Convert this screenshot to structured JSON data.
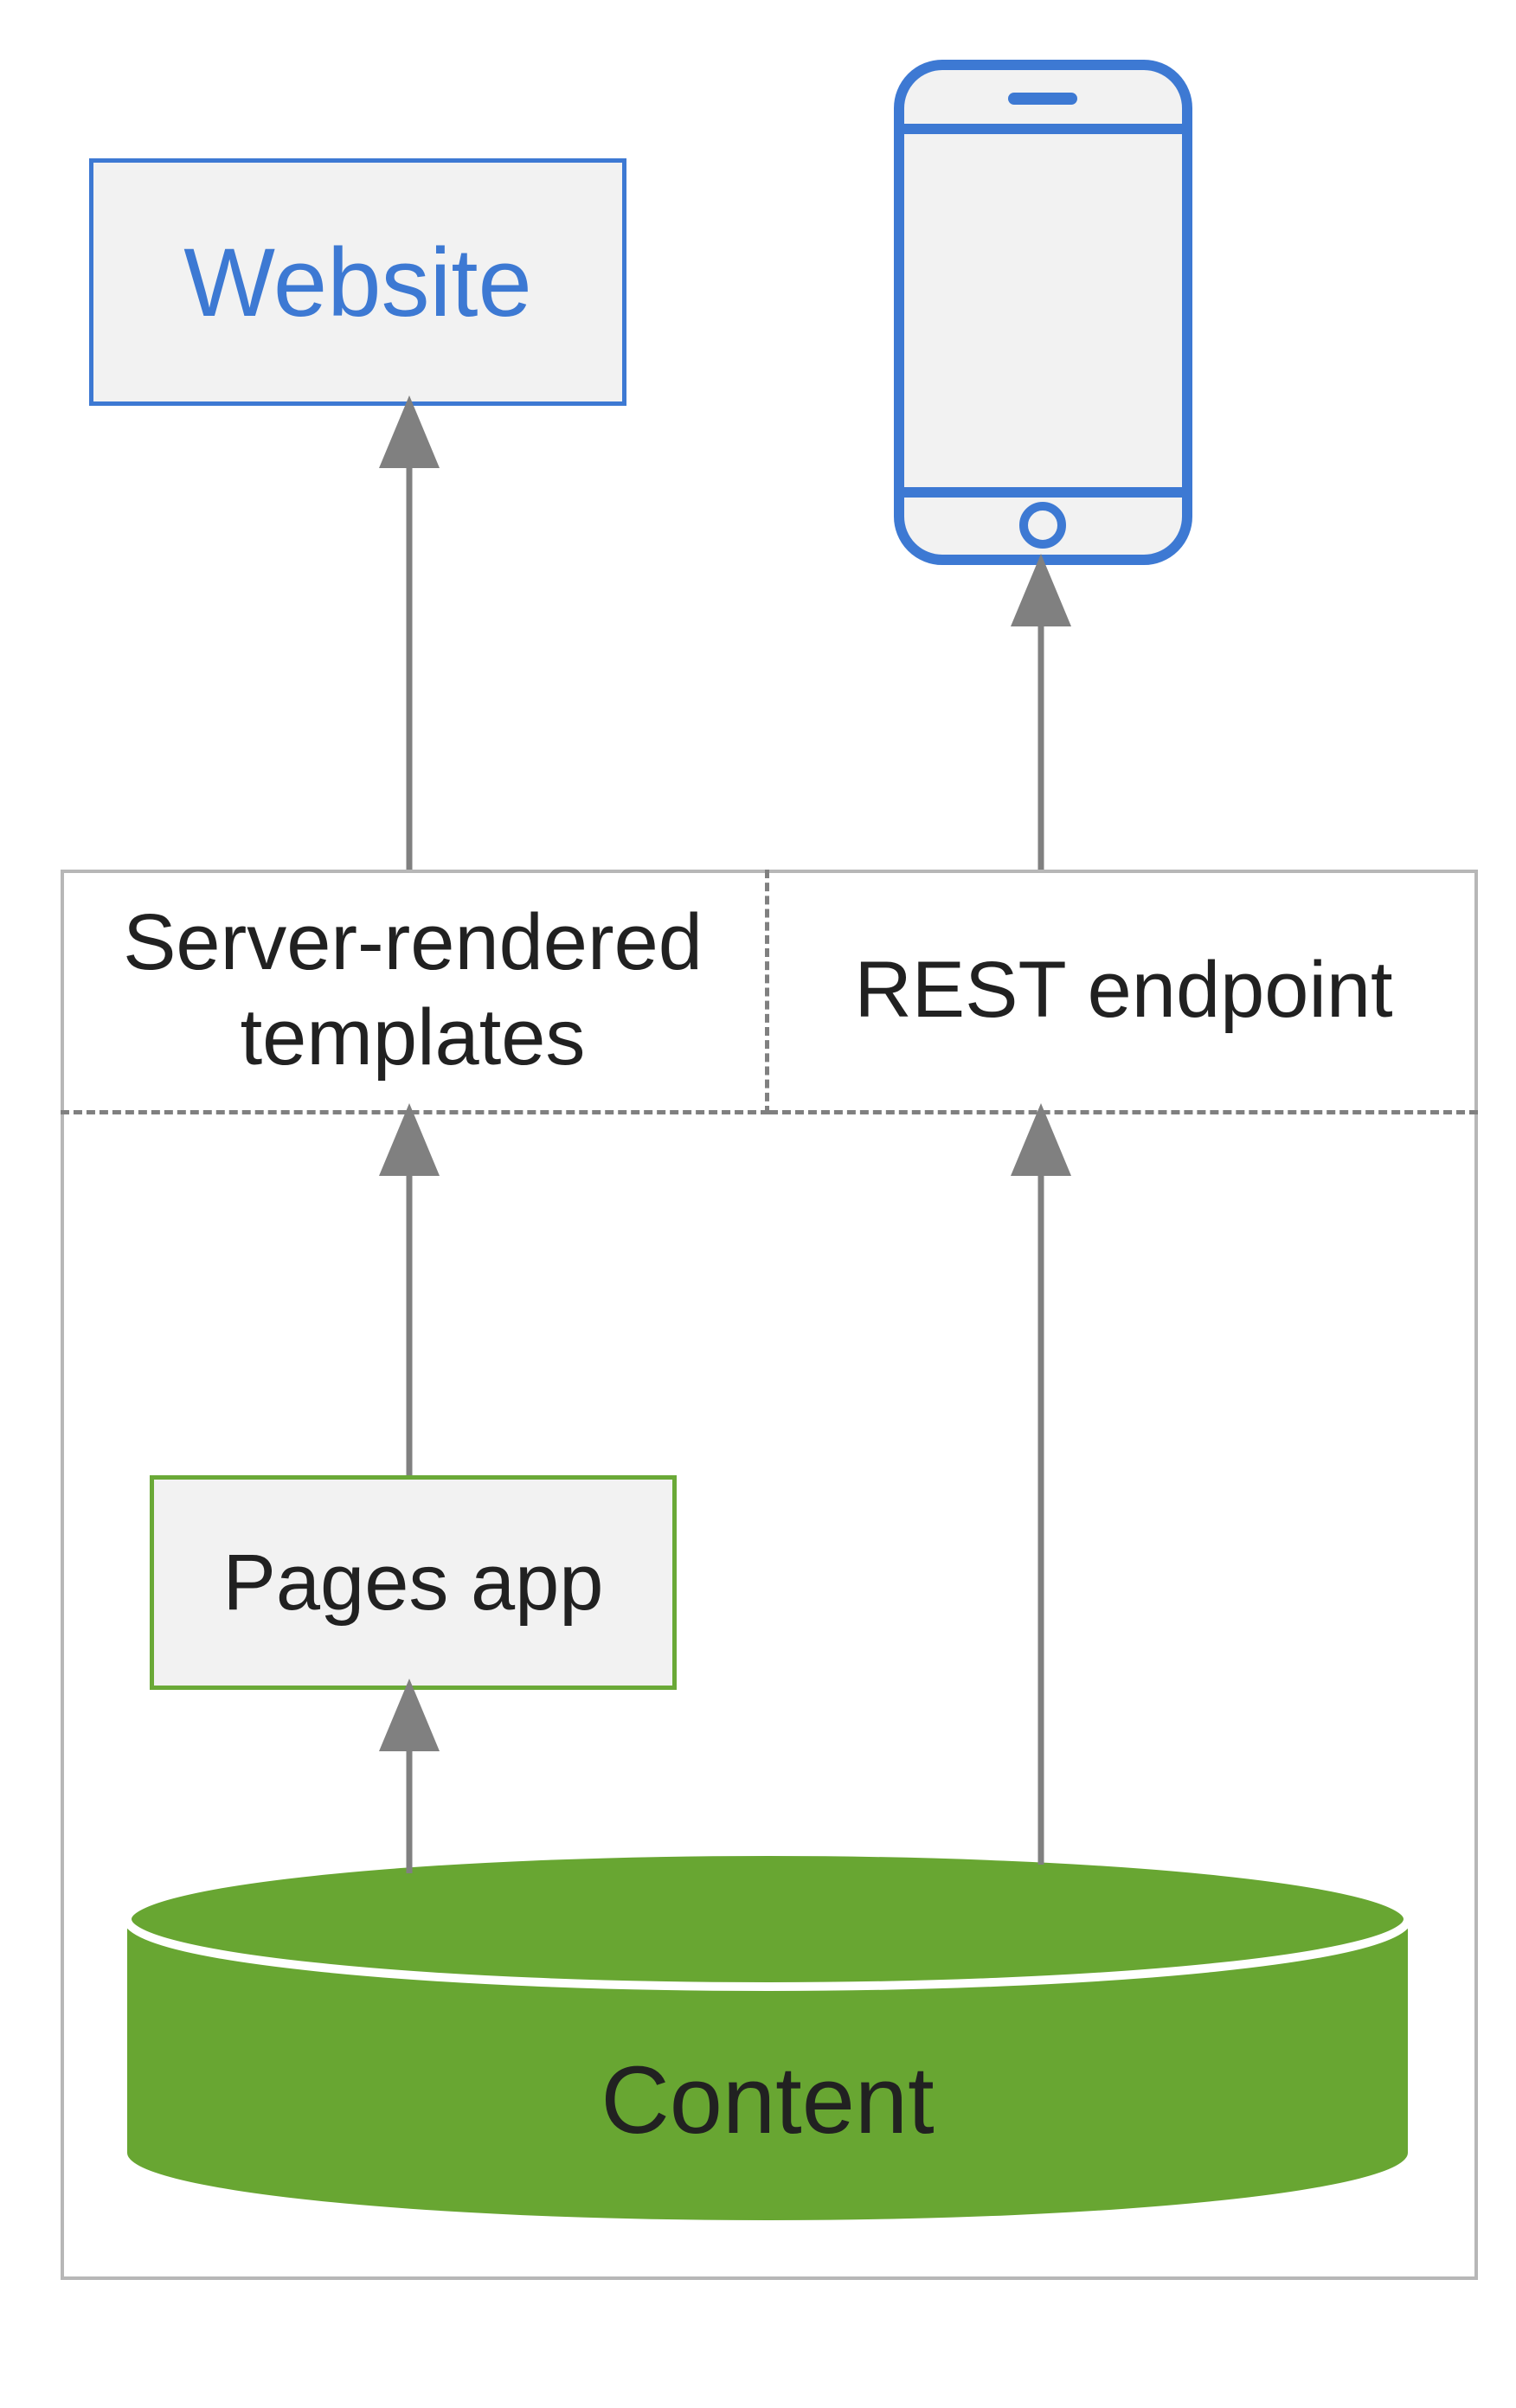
{
  "colors": {
    "blue": "#3d79d3",
    "green_border": "#6aa937",
    "green_fill": "#68a632",
    "gray_border": "#b7b7b7",
    "gray_dash": "#808080",
    "arrow": "#808080",
    "box_fill": "#f2f2f2",
    "text": "#212121"
  },
  "nodes": {
    "website": {
      "label": "Website"
    },
    "phone": {
      "label": "Mobile device"
    },
    "server_templates": {
      "label": "Server-rendered templates"
    },
    "rest_endpoint": {
      "label": "REST endpoint"
    },
    "pages_app": {
      "label": "Pages app"
    },
    "content": {
      "label": "Content"
    }
  },
  "edges": [
    {
      "from": "server_templates",
      "to": "website"
    },
    {
      "from": "rest_endpoint",
      "to": "phone"
    },
    {
      "from": "pages_app",
      "to": "server_templates"
    },
    {
      "from": "content",
      "to": "pages_app",
      "via": "left"
    },
    {
      "from": "content",
      "to": "rest_endpoint",
      "via": "right"
    }
  ]
}
